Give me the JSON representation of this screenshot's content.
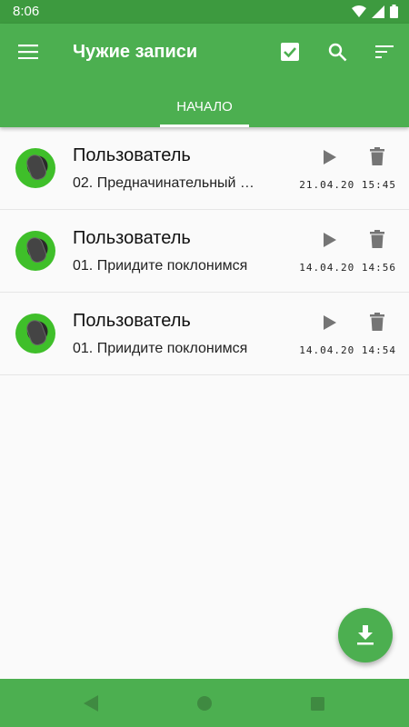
{
  "status_bar": {
    "time": "8:06"
  },
  "app_bar": {
    "title": "Чужие записи",
    "tabs": [
      {
        "label": "НАЧАЛО"
      }
    ]
  },
  "colors": {
    "primary": "#4caf50",
    "primary_dark": "#3d9a3f",
    "icon_gray": "#757575"
  },
  "records": [
    {
      "title": "Пользователь",
      "subtitle": "02. Предначинательный …",
      "datetime": "21.04.20 15:45"
    },
    {
      "title": "Пользователь",
      "subtitle": "01. Приидите поклонимся",
      "datetime": "14.04.20 14:56"
    },
    {
      "title": "Пользователь",
      "subtitle": "01. Приидите поклонимся",
      "datetime": "14.04.20 14:54"
    }
  ],
  "icons": {
    "menu": "menu-icon",
    "select_all": "checkbox-checked-icon",
    "search": "search-icon",
    "sort": "sort-icon",
    "play": "play-icon",
    "delete": "trash-icon",
    "download": "download-icon"
  }
}
